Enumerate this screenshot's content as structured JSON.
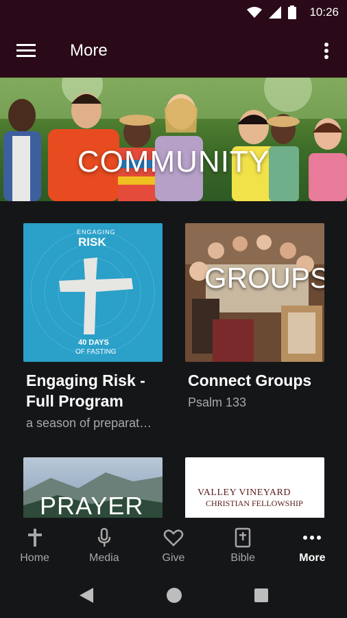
{
  "status_bar": {
    "time": "10:26"
  },
  "app_bar": {
    "title": "More"
  },
  "hero": {
    "label": "COMMUNITY"
  },
  "cards": [
    {
      "title": "Engaging Risk - Full Program",
      "subtitle": "a season of preparat…",
      "thumb_text": {
        "top": "ENGAGING",
        "main": "RISK",
        "bottom1": "40 DAYS",
        "bottom2": "OF FASTING"
      }
    },
    {
      "title": "Connect Groups",
      "subtitle": "Psalm 133",
      "thumb_text": {
        "main": "GROUPS"
      }
    },
    {
      "title": "",
      "subtitle": "",
      "thumb_text": {
        "main": "PRAYER"
      }
    },
    {
      "title": "",
      "subtitle": "",
      "thumb_text": {
        "line1": "VALLEY VINEYARD",
        "line2": "CHRISTIAN FELLOWSHIP"
      }
    }
  ],
  "bottom_nav": [
    {
      "label": "Home",
      "icon": "cross-icon",
      "active": false
    },
    {
      "label": "Media",
      "icon": "microphone-icon",
      "active": false
    },
    {
      "label": "Give",
      "icon": "heart-icon",
      "active": false
    },
    {
      "label": "Bible",
      "icon": "bible-icon",
      "active": false
    },
    {
      "label": "More",
      "icon": "more-dots-icon",
      "active": true
    }
  ],
  "colors": {
    "app_bar": "#2a0a18",
    "background": "#151618",
    "risk_card": "#2ba0c8"
  }
}
